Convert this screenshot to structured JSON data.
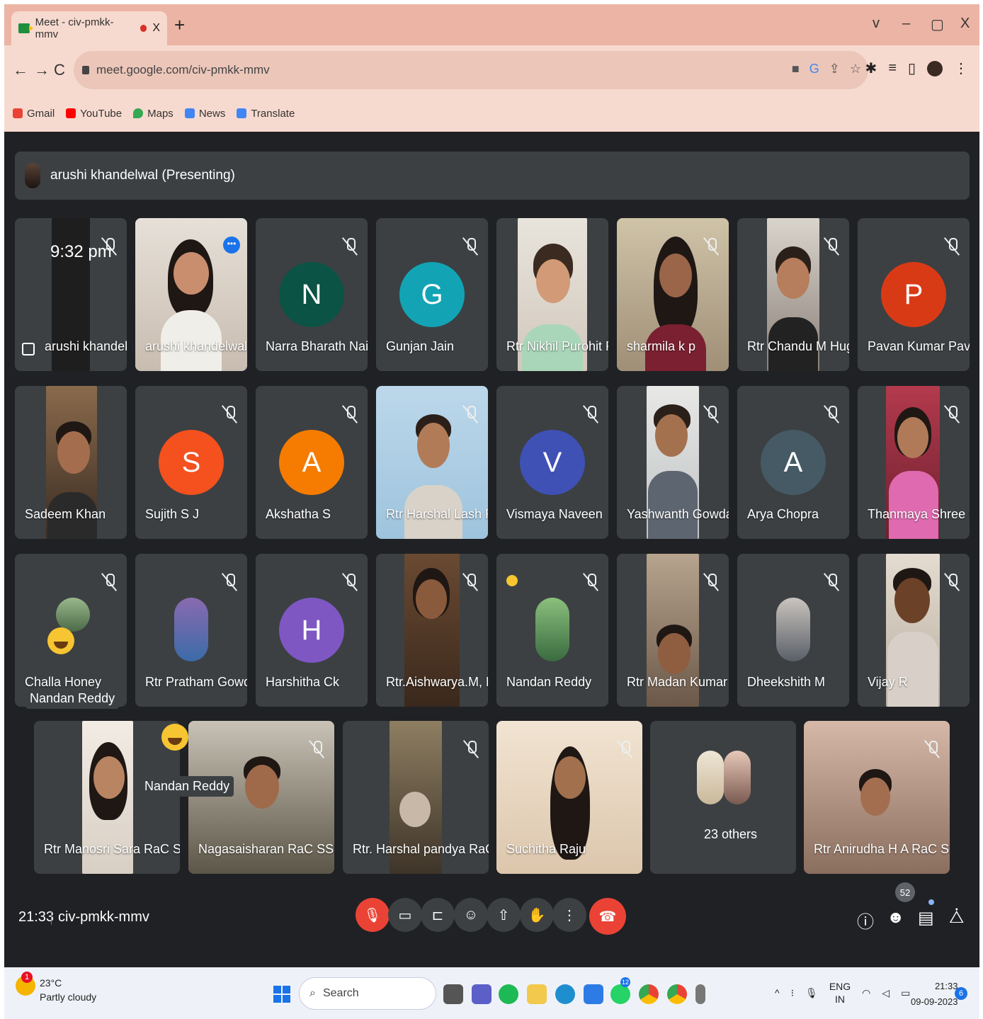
{
  "browser": {
    "tab_title": "Meet - civ-pmkk-mmv",
    "tab_close": "X",
    "new_tab": "+",
    "window_controls": {
      "menu": "v",
      "minimize": "–",
      "maximize": "▢",
      "close": "X"
    },
    "url": "meet.google.com/civ-pmkk-mmv",
    "nav": {
      "back": "←",
      "forward": "→",
      "reload": "C"
    },
    "bookmarks": [
      {
        "label": "Gmail",
        "color": "#ea4335"
      },
      {
        "label": "YouTube",
        "color": "#ff0000"
      },
      {
        "label": "Maps",
        "color": "#34a853"
      },
      {
        "label": "News",
        "color": "#4285f4"
      },
      {
        "label": "Translate",
        "color": "#4285f4"
      }
    ]
  },
  "meet": {
    "presenter_banner": "arushi khandelwal (Presenting)",
    "screen_tile_clock": "9:32 pm",
    "tiles": [
      {
        "name": "arushi khandel...",
        "type": "screen"
      },
      {
        "name": "arushi khandelwal",
        "type": "video",
        "selected": true
      },
      {
        "name": "Narra Bharath Naidu",
        "type": "letter",
        "letter": "N",
        "color": "#0b5345"
      },
      {
        "name": "Gunjan Jain",
        "type": "letter",
        "letter": "G",
        "color": "#12a4b5"
      },
      {
        "name": "Rtr Nikhil Purohit Ra...",
        "type": "video"
      },
      {
        "name": "sharmila k p",
        "type": "video"
      },
      {
        "name": "Rtr Chandu M Hugar...",
        "type": "video"
      },
      {
        "name": "Pavan Kumar Pavan ...",
        "type": "letter",
        "letter": "P",
        "color": "#d93a16"
      },
      {
        "name": "Sadeem Khan",
        "type": "video"
      },
      {
        "name": "Sujith S J",
        "type": "letter",
        "letter": "S",
        "color": "#f4511e"
      },
      {
        "name": "Akshatha S",
        "type": "letter",
        "letter": "A",
        "color": "#f57c00"
      },
      {
        "name": "Rtr Harshal Lash Ra...",
        "type": "video"
      },
      {
        "name": "Vismaya Naveen",
        "type": "letter",
        "letter": "V",
        "color": "#3f51b5"
      },
      {
        "name": "Yashwanth Gowda.S",
        "type": "video"
      },
      {
        "name": "Arya Chopra",
        "type": "letter",
        "letter": "A",
        "color": "#455a64"
      },
      {
        "name": "Thanmaya Shree G",
        "type": "video"
      },
      {
        "name": "Challa Honey",
        "type": "photo"
      },
      {
        "name": "Rtr Pratham Gowda...",
        "type": "photo"
      },
      {
        "name": "Harshitha Ck",
        "type": "letter",
        "letter": "H",
        "color": "#7e57c2"
      },
      {
        "name": "Rtr.Aishwarya.M, Ra...",
        "type": "video"
      },
      {
        "name": "Nandan Reddy",
        "type": "photo"
      },
      {
        "name": "Rtr Madan Kumar S ,...",
        "type": "video"
      },
      {
        "name": "Dheekshith M",
        "type": "photo"
      },
      {
        "name": "Vijay R",
        "type": "video"
      },
      {
        "name": "Rtr Manosri Sara RaC SSMR...",
        "type": "video"
      },
      {
        "name": "Nagasaisharan RaC SSMRV ...",
        "type": "video"
      },
      {
        "name": "Rtr. Harshal pandya RaC SS...",
        "type": "video"
      },
      {
        "name": "Suchitha Raju",
        "type": "video"
      },
      {
        "name": "23 others",
        "type": "others"
      },
      {
        "name": "Rtr Anirudha H A RaC SSMRV",
        "type": "video"
      }
    ],
    "reaction_tags": [
      "Nandan Reddy",
      "Nandan Reddy"
    ],
    "bottom": {
      "time": "21:33",
      "meeting_code": "civ-pmkk-mmv",
      "participant_count": "52"
    }
  },
  "taskbar": {
    "temperature": "23°C",
    "weather": "Partly cloudy",
    "weather_badge": "1",
    "search_placeholder": "Search",
    "whatsapp_badge": "12",
    "lang": "ENG",
    "region": "IN",
    "time": "21:33",
    "date": "09-09-2023",
    "notifications": "6"
  }
}
